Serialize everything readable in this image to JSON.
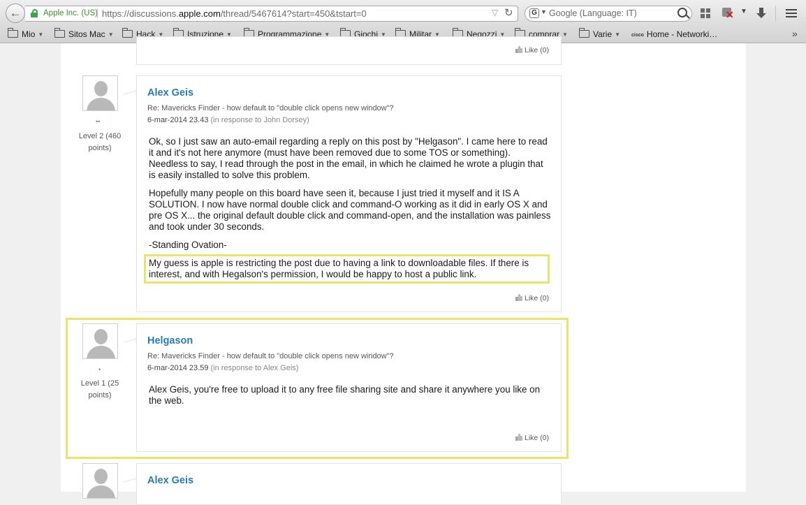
{
  "browser": {
    "site_identity": "Apple Inc. (US)",
    "url_prefix": "https://discussions.",
    "url_domain": "apple.com",
    "url_path": "/thread/5467614?start=450&tstart=0",
    "search_placeholder": "Google (Language: IT)",
    "search_engine_icon": "google-g-icon",
    "toolbar_icons": [
      "back-arrow-icon",
      "lock-icon",
      "reload-icon",
      "search-icon",
      "grid-icon",
      "adblock-icon",
      "download-icon",
      "hamburger-menu-icon"
    ]
  },
  "bookmarks": [
    {
      "label": "Mio"
    },
    {
      "label": "Sitos Mac"
    },
    {
      "label": "Hack"
    },
    {
      "label": "Istruzione"
    },
    {
      "label": "Programmazione"
    },
    {
      "label": "Giochi"
    },
    {
      "label": "Militar"
    },
    {
      "label": "Negozzi"
    },
    {
      "label": "comprar"
    },
    {
      "label": "Varie"
    },
    {
      "label": "Home - Networki…",
      "icon_text": "cisco"
    }
  ],
  "posts": [
    {
      "like": "Like (0)"
    },
    {
      "author": "Alex Geis",
      "subject": "Re: Mavericks Finder - how default to \"double click opens new window\"?",
      "date": "6-mar-2014 23.43",
      "in_response_to": "(in response to John Dorsey)",
      "level_line1": "Level 2 (460",
      "level_line2": "points)",
      "dots": "••",
      "paragraphs": [
        "Ok, so I just saw an auto-email regarding a reply on this post by \"Helgason\". I came here to read it and it's not here anymore (must have been removed due to some TOS or something). Needless to say, I read through the post in the email, in which he claimed he wrote a plugin that is easily installed to solve this problem.",
        "Hopefully many people on this board have seen it, because I just tried it myself and it IS A SOLUTION. I now have normal double click and command-O working as it did in early OS X and pre OS X... the original default double click and command-open, and the installation was painless and took under 30 seconds.",
        "-Standing Ovation-",
        "My guess is apple is restricting the post due to having a link to downloadable files. If there is interest, and with Hegalson's permission, I would be happy to host a public link."
      ],
      "like": "Like (0)"
    },
    {
      "author": "Helgason",
      "subject": "Re: Mavericks Finder - how default to \"double click opens new window\"?",
      "date": "6-mar-2014 23.59",
      "in_response_to": "(in response to Alex Geis)",
      "level_line1": "Level 1 (25",
      "level_line2": "points)",
      "dots": "•",
      "paragraphs": [
        "Alex Geis, you're free to upload it to any free file sharing site and share it anywhere you like on the web."
      ],
      "like": "Like (0)"
    },
    {
      "author": "Alex Geis"
    }
  ],
  "highlight_color": "#ebe36a",
  "author_link_color": "#2a7ab8"
}
